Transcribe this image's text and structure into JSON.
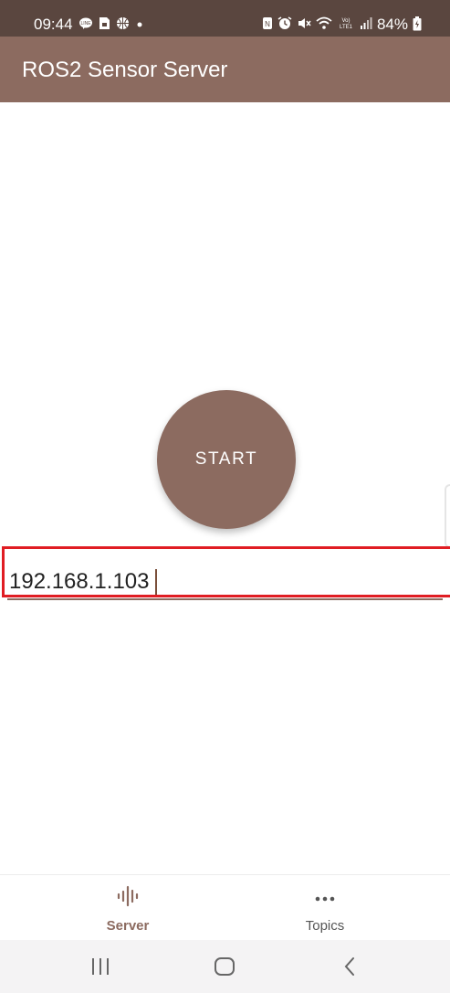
{
  "status_bar": {
    "time": "09:44",
    "left_icons": [
      "line-icon",
      "sim-icon",
      "ball-icon",
      "dot-icon"
    ],
    "right_icons": [
      "nfc-icon",
      "alarm-icon",
      "mute-icon",
      "wifi-icon",
      "lte-icon",
      "signal-icon"
    ],
    "lte_text": "Vo) LTE1",
    "battery": "84%"
  },
  "app_bar": {
    "title": "ROS2 Sensor Server"
  },
  "main": {
    "start_label": "START",
    "ip_value": "192.168.1.103"
  },
  "bottom_nav": {
    "items": [
      {
        "label": "Server",
        "icon": "waveform-icon",
        "active": true
      },
      {
        "label": "Topics",
        "icon": "more-horizontal-icon",
        "active": false
      }
    ]
  },
  "system_nav": [
    "recents-icon",
    "home-icon",
    "back-icon"
  ],
  "colors": {
    "status_bar": "#5a463f",
    "primary": "#8c6b60",
    "highlight": "#e01d23",
    "system_nav_bg": "#f4f3f4"
  }
}
